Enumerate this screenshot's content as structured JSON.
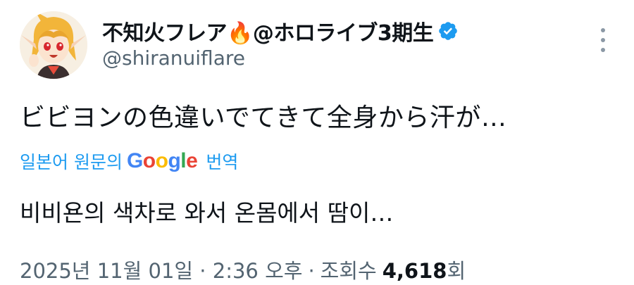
{
  "author": {
    "display_name": "不知火フレア🔥@ホロライブ3期生",
    "handle": "@shiranuiflare"
  },
  "tweet": {
    "text": "ビビヨンの色違いでてきて全身から汗が…"
  },
  "translation": {
    "label": "일본어 원문의",
    "provider_letters": [
      "G",
      "o",
      "o",
      "g",
      "l",
      "e"
    ],
    "action": "번역",
    "translated_text": "비비욘의 색차로 와서 온몸에서 땀이…"
  },
  "meta": {
    "timestamp": "2025년 11월 01일 · 2:36 오후",
    "separator": "·",
    "views_label": "조회수",
    "views_count": "4,618",
    "views_suffix": "회"
  },
  "icons": {
    "verified": "verified-badge-icon",
    "more": "more-options-icon"
  },
  "colors": {
    "link": "#1d9bf0",
    "secondary_text": "#536471",
    "primary_text": "#0f1419",
    "verified": "#1d9bf0"
  }
}
